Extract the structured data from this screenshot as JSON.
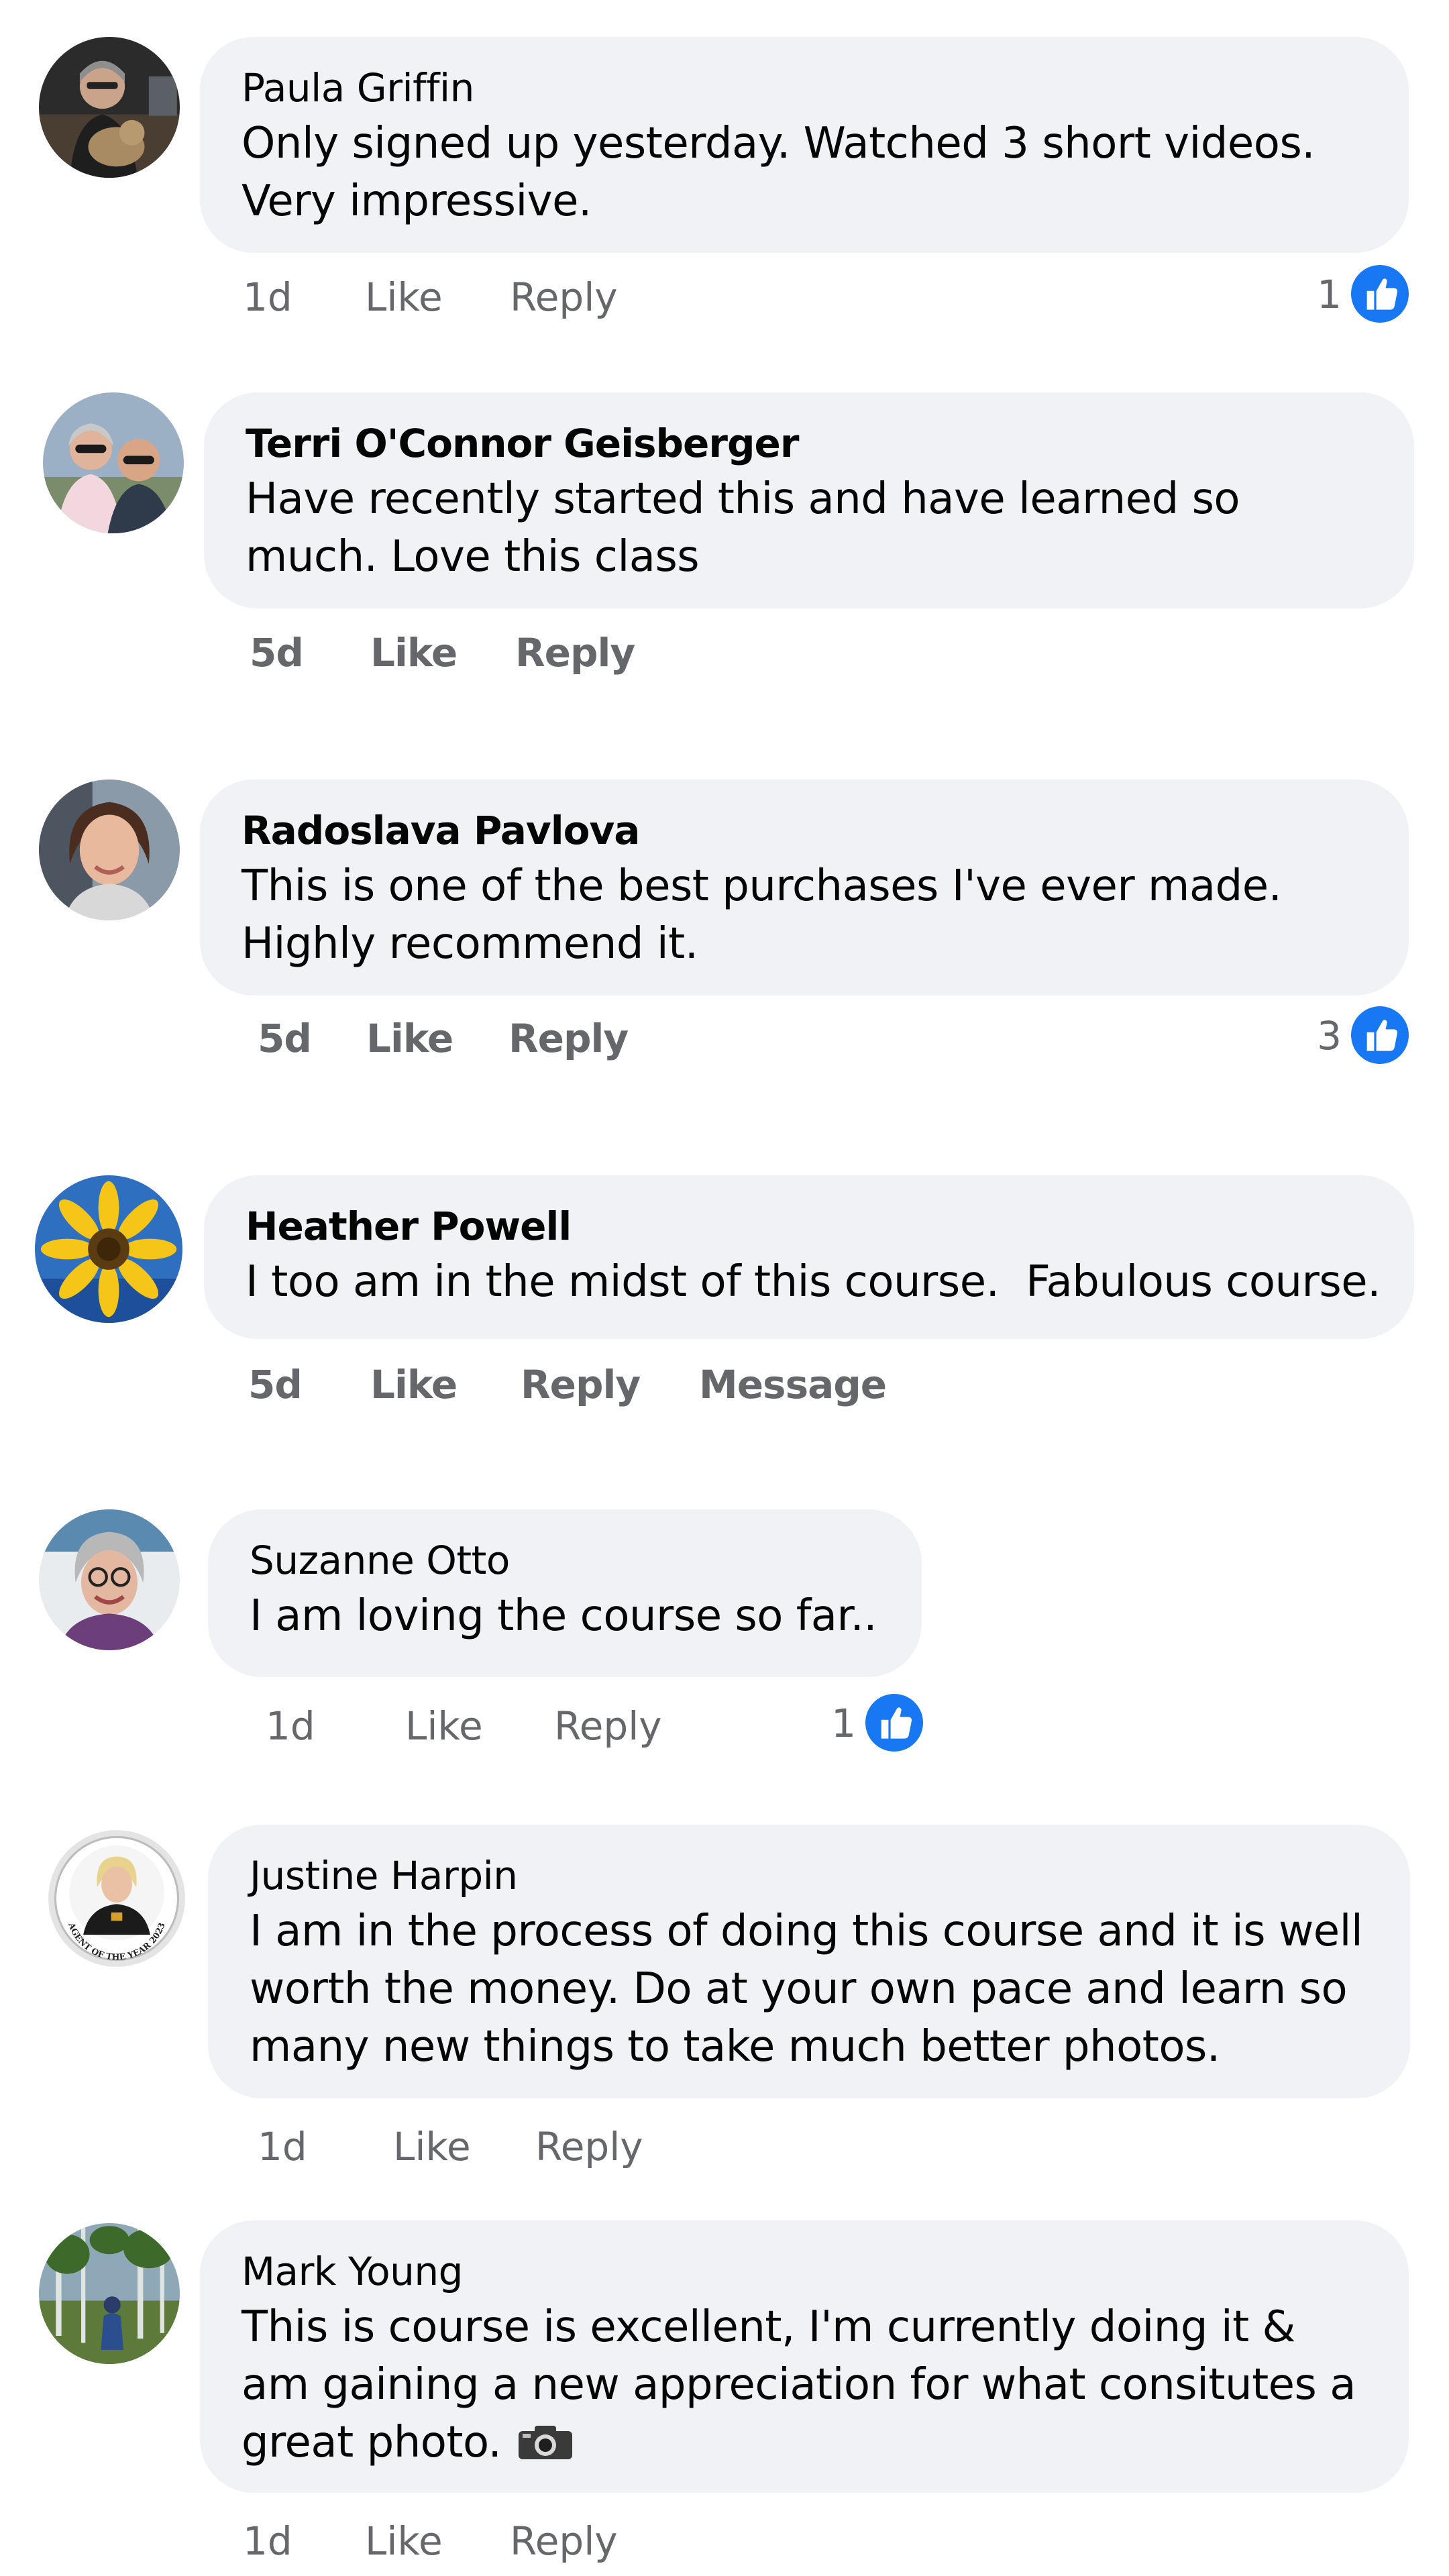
{
  "comments": [
    {
      "author": "Paula Griffin",
      "text": "Only signed up yesterday. Watched 3 short videos. Very impressive.",
      "time": "1d",
      "like_label": "Like",
      "reply_label": "Reply",
      "reaction_count": "1",
      "avatar_icon": "person-with-dog-avatar"
    },
    {
      "author": "Terri O'Connor Geisberger",
      "text": "Have recently started this and have learned so much. Love this class",
      "time": "5d",
      "like_label": "Like",
      "reply_label": "Reply",
      "avatar_icon": "couple-avatar"
    },
    {
      "author": "Radoslava Pavlova",
      "text": "This is one of the best purchases I've ever made. Highly recommend it.",
      "time": "5d",
      "like_label": "Like",
      "reply_label": "Reply",
      "reaction_count": "3",
      "avatar_icon": "woman-portrait-avatar"
    },
    {
      "author": "Heather Powell",
      "text": "I too am in the midst of this course.  Fabulous course.",
      "time": "5d",
      "like_label": "Like",
      "reply_label": "Reply",
      "message_label": "Message",
      "avatar_icon": "sunflower-avatar"
    },
    {
      "author": "Suzanne Otto",
      "text": "I am loving the course so far..",
      "time": "1d",
      "like_label": "Like",
      "reply_label": "Reply",
      "reaction_count": "1",
      "avatar_icon": "woman-glasses-avatar"
    },
    {
      "author": "Justine Harpin",
      "text": "I am in the process of doing this course and it is well worth the money. Do at your own pace and learn so many new things to take much better photos.",
      "time": "1d",
      "like_label": "Like",
      "reply_label": "Reply",
      "avatar_icon": "agent-of-the-year-badge-avatar",
      "avatar_badge_text": "AGENT OF THE YEAR 2023"
    },
    {
      "author": "Mark Young",
      "text": "This is course is excellent, I'm currently doing it & am gaining a new appreciation for what consitutes a great photo.",
      "emoji": "camera-emoji",
      "time": "1d",
      "like_label": "Like",
      "reply_label": "Reply",
      "avatar_icon": "forest-avatar"
    }
  ],
  "colors": {
    "bubble_bg": "#f0f2f5",
    "meta_text": "#65676b",
    "like_blue": "#1877f2",
    "text": "#050505"
  }
}
